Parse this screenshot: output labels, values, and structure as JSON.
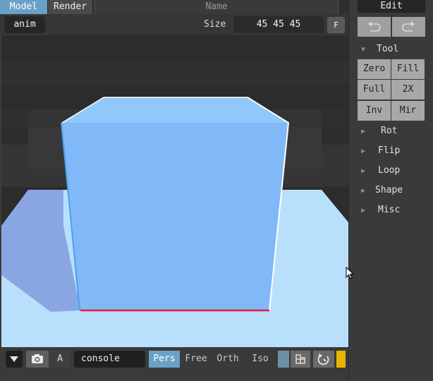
{
  "topbar": {
    "tab_model": "Model",
    "tab_render": "Render",
    "name_placeholder": "Name"
  },
  "toolbar": {
    "anim_label": "anim",
    "size_label": "Size",
    "size_value": "45 45 45",
    "f_label": "F"
  },
  "bottombar": {
    "a_label": "A",
    "console_value": "console",
    "projections": [
      "Pers",
      "Free",
      "Orth",
      "Iso"
    ],
    "active_projection": "Pers"
  },
  "panel": {
    "edit_label": "Edit",
    "tool_section": "Tool",
    "tool_buttons": [
      "Zero",
      "Fill",
      "Full",
      "2X",
      "Inv",
      "Mir"
    ],
    "collapsed_sections": [
      "Rot",
      "Flip",
      "Loop",
      "Shape",
      "Misc"
    ]
  },
  "colors": {
    "accent": "#6aa0c8",
    "cube_front": "#80b8f8",
    "cube_top": "#90c8fc",
    "floor": "#b8e0fc",
    "shadow": "#8aa6e2",
    "edge_red": "#e0203a",
    "highlight_yellow": "#e8b400"
  },
  "icons": [
    "chevron-down-icon",
    "camera-icon",
    "grid-icon",
    "rotate-icon",
    "undo-icon",
    "redo-icon",
    "triangle-down-icon",
    "triangle-right-icon",
    "mouse-cursor-icon"
  ]
}
